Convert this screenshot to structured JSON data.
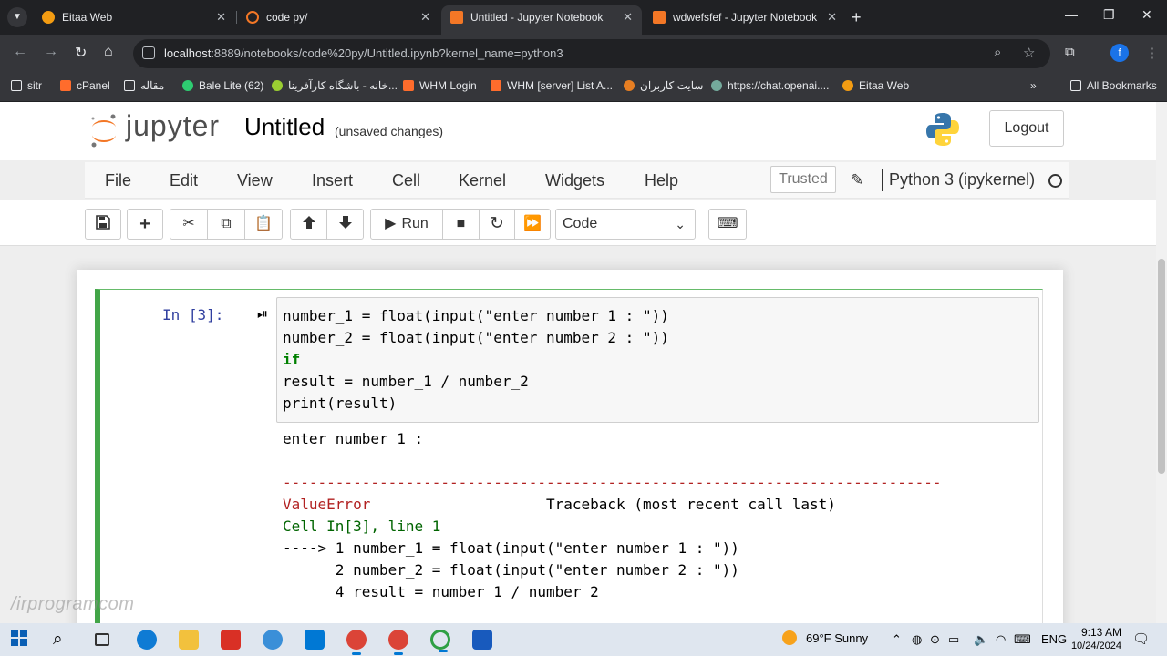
{
  "browser": {
    "tabs": [
      {
        "title": "Eitaa Web",
        "color": "#f39c12",
        "active": false
      },
      {
        "title": "code py/",
        "color": "#f37726",
        "active": false
      },
      {
        "title": "Untitled - Jupyter Notebook",
        "color": "#f37726",
        "active": true
      },
      {
        "title": "wdwefsfef - Jupyter Notebook",
        "color": "#f37726",
        "active": false
      }
    ],
    "url_host": "localhost",
    "url_rest": ":8889/notebooks/code%20py/Untitled.ipynb?kernel_name=python3",
    "profile_letter": "f",
    "bookmarks": [
      {
        "label": "sitr",
        "color": "#e8eaed"
      },
      {
        "label": "cPanel",
        "color": "#ff6c2c"
      },
      {
        "label": "مقاله",
        "color": "#e8eaed"
      },
      {
        "label": "Bale Lite (62)",
        "color": "#2ecc71"
      },
      {
        "label": "خانه - باشگاه کارآفرینا...",
        "color": "#9acd32"
      },
      {
        "label": "WHM Login",
        "color": "#ff6c2c"
      },
      {
        "label": "WHM [server] List A...",
        "color": "#ff6c2c"
      },
      {
        "label": "سایت کاربران",
        "color": "#e67e22"
      },
      {
        "label": "https://chat.openai....",
        "color": "#74aa9c"
      },
      {
        "label": "Eitaa Web",
        "color": "#f39c12"
      }
    ],
    "all_bookmarks": "All Bookmarks"
  },
  "jupyter": {
    "logo_text": "jupyter",
    "notebook_name": "Untitled",
    "save_status": "(unsaved changes)",
    "logout": "Logout",
    "menu": [
      "File",
      "Edit",
      "View",
      "Insert",
      "Cell",
      "Kernel",
      "Widgets",
      "Help"
    ],
    "trusted": "Trusted",
    "kernel": "Python 3 (ipykernel)",
    "run_label": "Run",
    "cell_type": "Code"
  },
  "cell": {
    "prompt": "In [3]:",
    "code_lines": [
      "number_1 = float(input(\"enter number 1 : \"))",
      "number_2 = float(input(\"enter number 2 : \"))",
      "if",
      "result = number_1 / number_2",
      "print(result)"
    ],
    "output": {
      "stdout": "enter number 1 :",
      "separator": "---------------------------------------------------------------------------",
      "error_name": "ValueError",
      "traceback_header": "Traceback (most recent call last)",
      "location": "Cell In[3], line 1",
      "tb_lines": [
        "----> 1 number_1 = float(input(\"enter number 1 : \"))",
        "      2 number_2 = float(input(\"enter number 2 : \"))",
        "      4 result = number_1 / number_2"
      ]
    }
  },
  "watermark": "/irprogramcom",
  "taskbar": {
    "weather": "69°F  Sunny",
    "language": "ENG",
    "time": "9:13 AM",
    "date": "10/24/2024"
  }
}
